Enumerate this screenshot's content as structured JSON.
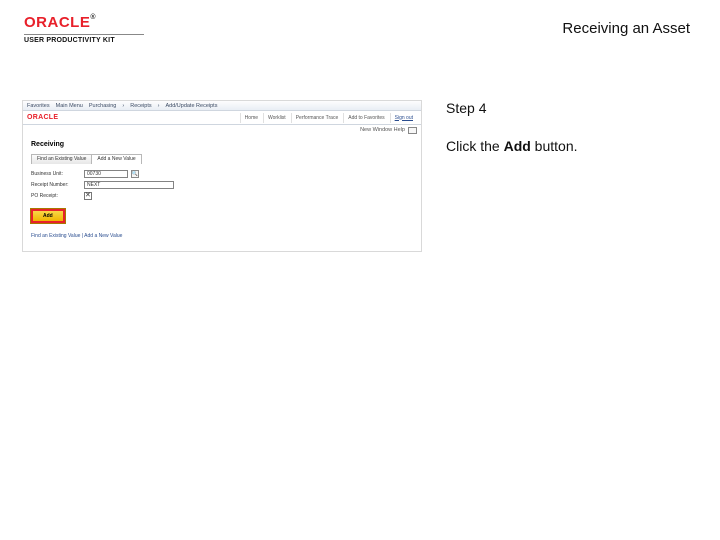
{
  "header": {
    "brand": "ORACLE",
    "brand_tm": "®",
    "subbrand": "USER PRODUCTIVITY KIT",
    "title": "Receiving an Asset"
  },
  "instruction": {
    "step_label": "Step 4",
    "text_prefix": "Click the ",
    "button_name": "Add",
    "text_suffix": " button."
  },
  "shot": {
    "breadcrumb": [
      "Favorites",
      "Main Menu",
      "Purchasing",
      "Receipts",
      "Add/Update Receipts"
    ],
    "brand": "ORACLE",
    "nav": [
      "Home",
      "Worklist",
      "Performance Trace",
      "Add to Favorites",
      "Sign out"
    ],
    "util_label": "New Window  Help",
    "page_title": "Receiving",
    "tabs": [
      "Find an Existing Value",
      "Add a New Value"
    ],
    "fields": {
      "business_unit": {
        "label": "Business Unit:",
        "value": "00730"
      },
      "receipt_number": {
        "label": "Receipt Number:",
        "value": "NEXT"
      },
      "po_receipt": {
        "label": "PO Receipt:",
        "checked": true
      }
    },
    "add_button": "Add",
    "footer_link": "Find an Existing Value | Add a New Value"
  }
}
